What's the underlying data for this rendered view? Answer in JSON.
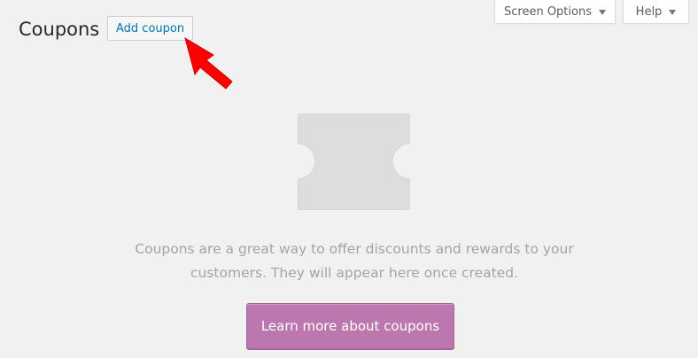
{
  "header": {
    "title": "Coupons",
    "add_label": "Add coupon"
  },
  "screen_meta": {
    "screen_options_label": "Screen Options",
    "help_label": "Help"
  },
  "blank_state": {
    "message_line1": "Coupons are a great way to offer discounts and rewards to your",
    "message_line2": "customers. They will appear here once created.",
    "cta_label": "Learn more about coupons"
  },
  "colors": {
    "background": "#f1f1f1",
    "link": "#0073aa",
    "cta": "#bb77ae",
    "arrow": "#ff0000",
    "placeholder_icon": "#dddddd"
  },
  "icons": {
    "annotation": "red-arrow-icon",
    "placeholder": "coupon-ticket-icon",
    "dropdown": "caret-down-icon"
  }
}
